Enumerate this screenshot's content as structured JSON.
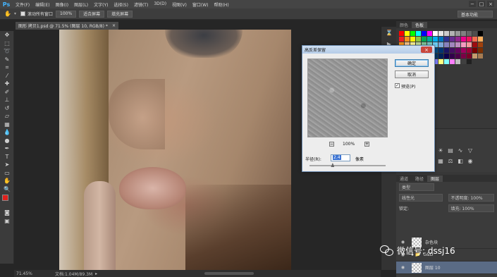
{
  "app": {
    "logo": "Ps"
  },
  "menu": [
    "文件(F)",
    "编辑(E)",
    "图像(I)",
    "图层(L)",
    "文字(Y)",
    "选择(S)",
    "滤镜(T)",
    "3D(D)",
    "视图(V)",
    "窗口(W)",
    "帮助(H)"
  ],
  "window_controls": [
    "−",
    "□",
    "×"
  ],
  "options_bar": {
    "scroll_all_label": "滚动所有窗口",
    "zoom_btn": "100%",
    "fit_screen_btn": "适合屏幕",
    "fill_screen_btn": "填充屏幕",
    "workspace": "基本功能"
  },
  "document_tab": {
    "title": "图形 拷贝1.psd @ 71.5% (图层 10, RGB/8) *",
    "close": "×"
  },
  "status_bar": {
    "zoom": "71.45%",
    "doc_info": "文档:1.04M/89.3M"
  },
  "right_panel": {
    "swatch_tabs": [
      "颜色",
      "色板"
    ],
    "swatch_colors": [
      "#ff0000",
      "#ffff00",
      "#00ff00",
      "#00ffff",
      "#0000ff",
      "#ff00ff",
      "#ffffff",
      "#e6e6e6",
      "#cccccc",
      "#b3b3b3",
      "#999999",
      "#808080",
      "#666666",
      "#4d4d4d",
      "#000000",
      "#ee1d24",
      "#f6921e",
      "#fff200",
      "#8dc63f",
      "#00a651",
      "#00a99d",
      "#00aeef",
      "#0072bc",
      "#2e3192",
      "#662d91",
      "#92278f",
      "#ec008c",
      "#ed145b",
      "#f26c4f",
      "#fbaf5d",
      "#f7941d",
      "#fdc689",
      "#fff799",
      "#c4df9b",
      "#82ca9c",
      "#7accc8",
      "#6dcff6",
      "#7da7d9",
      "#8781bd",
      "#a186be",
      "#bd8cbf",
      "#f49ac1",
      "#f5989d",
      "#9e0b0f",
      "#a0410d",
      "#aba000",
      "#598527",
      "#1a7b30",
      "#007236",
      "#00746b",
      "#0076a3",
      "#004a80",
      "#003471",
      "#1b1464",
      "#440e62",
      "#630460",
      "#9e005d",
      "#9e0039",
      "#790000",
      "#7b2e00",
      "#827b00",
      "#406618",
      "#005e20",
      "#005826",
      "#005952",
      "#005b7f",
      "#003663",
      "#002157",
      "#0d004c",
      "#32004b",
      "#4b0049",
      "#7b0046",
      "#7a0026",
      "#c69c6d",
      "#a67c52",
      "#8c6239",
      "#754c24",
      "#603913",
      "#3c2415",
      "#ff8080",
      "#80ff80",
      "#8080ff",
      "#ffff80",
      "#80ffff",
      "#ff80ff",
      "#c0c0c0",
      "#404040",
      "#202020"
    ],
    "layers_tabs": [
      "通道",
      "路径",
      "图层"
    ],
    "layer_filter": "类型",
    "blend_mode": "线性光",
    "opacity_label": "不透明度: 100%",
    "lock_label": "锁定:",
    "fill_label": "填充: 100%",
    "layers": [
      {
        "name": "杂色块"
      },
      {
        "name": "G&D"
      },
      {
        "name": "图层 10"
      }
    ]
  },
  "dialog": {
    "title": "高反差保留",
    "close": "×",
    "ok": "确定",
    "cancel": "取消",
    "preview_label": "预览(P)",
    "preview_zoom": "100%",
    "radius_label": "半径(R):",
    "radius_value": "2.4",
    "radius_unit": "像素",
    "radius_level": 0.3
  },
  "watermark": {
    "text": "微信号: dssj16"
  }
}
